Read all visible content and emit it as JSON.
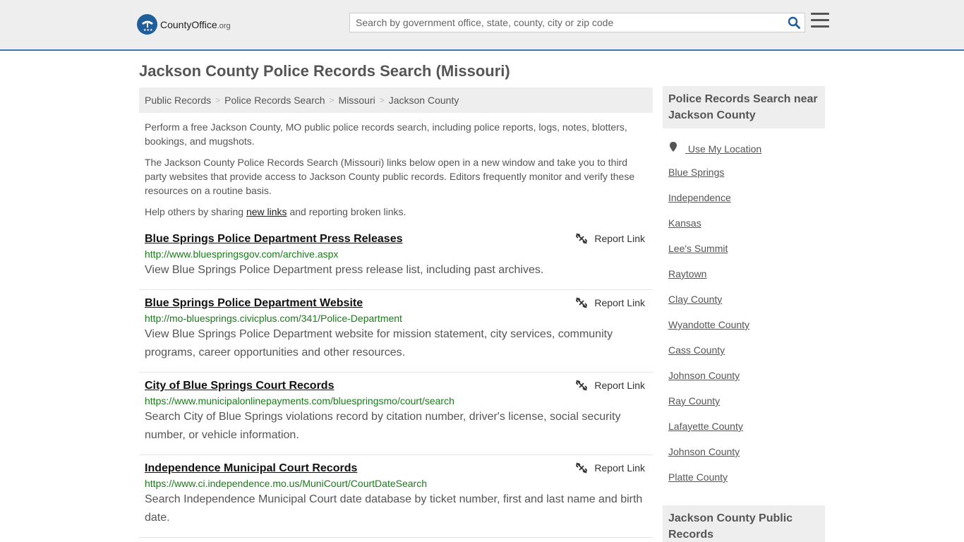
{
  "header": {
    "logo_main": "CountyOffice",
    "logo_suffix": ".org",
    "search_placeholder": "Search by government office, state, county, city or zip code"
  },
  "page": {
    "title": "Jackson County Police Records Search (Missouri)"
  },
  "breadcrumb": [
    "Public Records",
    "Police Records Search",
    "Missouri",
    "Jackson County"
  ],
  "intro": {
    "p1": "Perform a free Jackson County, MO public police records search, including police reports, logs, notes, blotters, bookings, and mugshots.",
    "p2": "The Jackson County Police Records Search (Missouri) links below open in a new window and take you to third party websites that provide access to Jackson County public records. Editors frequently monitor and verify these resources on a routine basis.",
    "p3_before": "Help others by sharing ",
    "p3_link": "new links",
    "p3_after": " and reporting broken links."
  },
  "results": [
    {
      "title": "Blue Springs Police Department Press Releases",
      "url": "http://www.bluespringsgov.com/archive.aspx",
      "desc": "View Blue Springs Police Department press release list, including past archives.",
      "report": "Report Link"
    },
    {
      "title": "Blue Springs Police Department Website",
      "url": "http://mo-bluesprings.civicplus.com/341/Police-Department",
      "desc": "View Blue Springs Police Department website for mission statement, city services, community programs, career opportunities and other resources.",
      "report": "Report Link"
    },
    {
      "title": "City of Blue Springs Court Records",
      "url": "https://www.municipalonlinepayments.com/bluespringsmo/court/search",
      "desc": "Search City of Blue Springs violations record by citation number, driver's license, social security number, or vehicle information.",
      "report": "Report Link"
    },
    {
      "title": "Independence Municipal Court Records",
      "url": "https://www.ci.independence.mo.us/MuniCourt/CourtDateSearch",
      "desc": "Search Independence Municipal Court date database by ticket number, first and last name and birth date.",
      "report": "Report Link"
    }
  ],
  "sidebar": {
    "heading": "Police Records Search near Jackson County",
    "use_location": "Use My Location",
    "links": [
      "Blue Springs",
      "Independence",
      "Kansas",
      "Lee's Summit",
      "Raytown",
      "Clay County",
      "Wyandotte County",
      "Cass County",
      "Johnson County",
      "Ray County",
      "Lafayette County",
      "Johnson County",
      "Platte County"
    ],
    "heading2": "Jackson County Public Records"
  }
}
